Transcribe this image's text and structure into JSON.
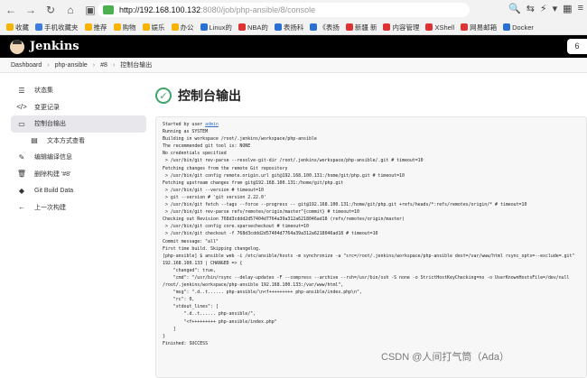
{
  "browser": {
    "url_host": "http://192.168.100.132",
    "url_rest": ":8080/job/php-ansible/8/console",
    "nav_icons": [
      "back-icon",
      "forward-icon",
      "refresh-icon",
      "home-icon",
      "folder-icon"
    ]
  },
  "bookmarks": [
    {
      "label": "收藏",
      "color": "#f5b400"
    },
    {
      "label": "手机收藏夹",
      "color": "#3b7de0"
    },
    {
      "label": "推荐",
      "color": "#f5b400"
    },
    {
      "label": "购物",
      "color": "#f5b400"
    },
    {
      "label": "娱乐",
      "color": "#f5b400"
    },
    {
      "label": "办公",
      "color": "#f5b400"
    },
    {
      "label": "Linux的",
      "color": "#2a70d4"
    },
    {
      "label": "NBA的",
      "color": "#d33"
    },
    {
      "label": "表扬科",
      "color": "#2a70d4"
    },
    {
      "label": "《表扬",
      "color": "#2a70d4"
    },
    {
      "label": "新疆 新",
      "color": "#d33"
    },
    {
      "label": "内容管理",
      "color": "#d33"
    },
    {
      "label": "XShell",
      "color": "#d33"
    },
    {
      "label": "网易邮箱",
      "color": "#d33"
    },
    {
      "label": "Docker",
      "color": "#2a70d4"
    }
  ],
  "header": {
    "title": "Jenkins",
    "search_label": "6"
  },
  "breadcrumb": [
    "Dashboard",
    "php-ansible",
    "#8",
    "控制台输出"
  ],
  "sidebar": [
    {
      "label": "状态集",
      "icon": "☰",
      "name": "status",
      "sub": false,
      "active": false
    },
    {
      "label": "变更记录",
      "icon": "</>",
      "name": "changes",
      "sub": false,
      "active": false
    },
    {
      "label": "控制台输出",
      "icon": "▭",
      "name": "console-output",
      "sub": false,
      "active": true
    },
    {
      "label": "文本方式查看",
      "icon": "▤",
      "name": "view-as-text",
      "sub": true,
      "active": false
    },
    {
      "label": "编辑编译信息",
      "icon": "✎",
      "name": "edit-build-info",
      "sub": false,
      "active": false
    },
    {
      "label": "删除构建 '#8'",
      "icon": "🗑",
      "name": "delete-build",
      "sub": false,
      "active": false
    },
    {
      "label": "Git Build Data",
      "icon": "◆",
      "name": "git-build-data",
      "sub": false,
      "active": false
    },
    {
      "label": "上一次构建",
      "icon": "←",
      "name": "previous-build",
      "sub": false,
      "active": false
    }
  ],
  "main": {
    "title": "控制台输出",
    "console_user": "admin",
    "console_lines": [
      "Started by user ",
      "Running as SYSTEM",
      "Building in workspace /root/.jenkins/workspace/php-ansible",
      "The recommended git tool is: NONE",
      "No credentials specified",
      " > /usr/bin/git rev-parse --resolve-git-dir /root/.jenkins/workspace/php-ansible/.git # timeout=10",
      "Fetching changes from the remote Git repository",
      " > /usr/bin/git config remote.origin.url git@192.168.100.131:/home/git/php.git # timeout=10",
      "Fetching upstream changes from git@192.168.100.131:/home/git/php.git",
      " > /usr/bin/git --version # timeout=10",
      " > git --version # 'git version 2.22.0'",
      " > /usr/bin/git fetch --tags --force --progress -- git@192.168.100.131:/home/git/php.git +refs/heads/*:refs/remotes/origin/* # timeout=10",
      " > /usr/bin/git rev-parse refs/remotes/origin/master^{commit} # timeout=10",
      "Checking out Revision 768d3cddd2d57404d7764a39a312a6218046ad18 (refs/remotes/origin/master)",
      " > /usr/bin/git config core.sparsecheckout # timeout=10",
      " > /usr/bin/git checkout -f 768d3cddd2d57404d7764a39a312a6218046ad18 # timeout=10",
      "Commit message: \"all\"",
      "First time build. Skipping changelog.",
      "[php-ansible] $ ansible web -i /etc/ansible/hosts -m synchronize -a \"src=/root/.jenkins/workspace/php-ansible dest=/var/www/html rsync_opts=--exclude=.git\"",
      "192.168.100.133 | CHANGED => {",
      "    \"changed\": true,",
      "    \"cmd\": \"/usr/bin/rsync --delay-updates -F --compress --archive --rsh=/usr/bin/ssh -S none -o StrictHostKeyChecking=no -o UserKnownHostsFile=/dev/null",
      "/root/.jenkins/workspace/php-ansible 192.168.100.133:/var/www/html\",",
      "    \"msg\": \".d..t...... php-ansible/\\n<f+++++++++ php-ansible/index.php\\n\",",
      "    \"rc\": 0,",
      "    \"stdout_lines\": [",
      "        \".d..t...... php-ansible/\",",
      "        \"<f+++++++++ php-ansible/index.php\"",
      "    ]",
      "}",
      "Finished: SUCCESS"
    ]
  },
  "watermark": "CSDN @人间打气筒（Ada）"
}
